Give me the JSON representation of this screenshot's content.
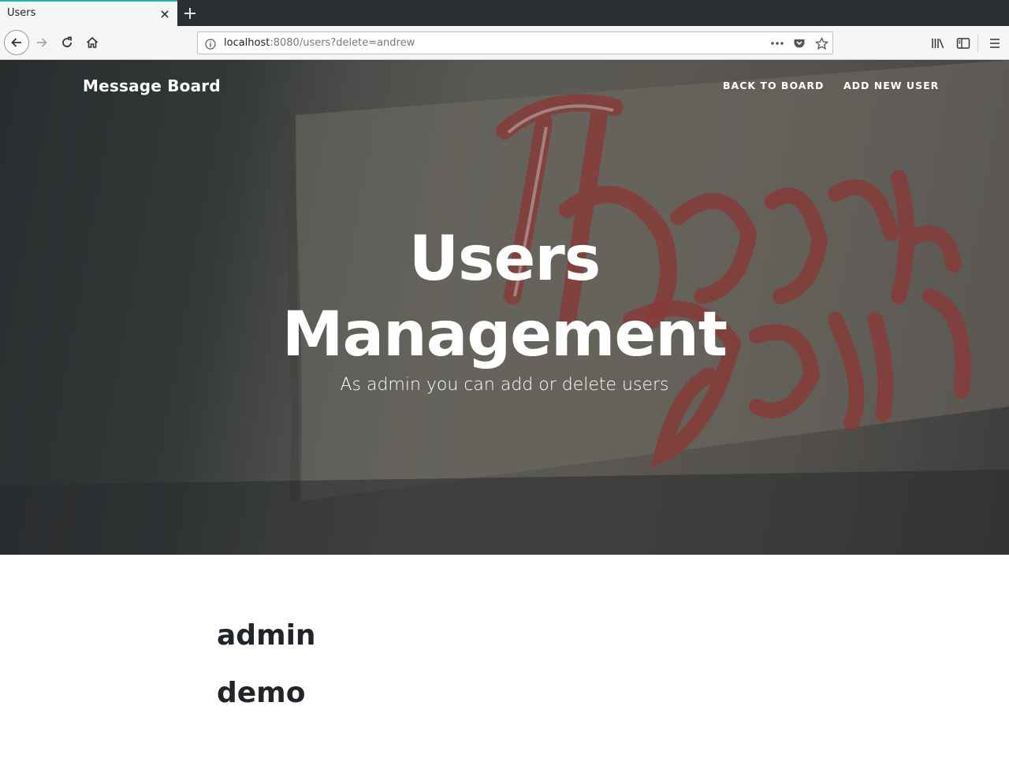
{
  "browser": {
    "tab": {
      "title": "Users"
    },
    "url": {
      "host": "localhost",
      "rest": ":8080/users?delete=andrew"
    }
  },
  "nav": {
    "brand": "Message Board",
    "links": [
      {
        "label": "BACK TO BOARD"
      },
      {
        "label": "ADD NEW USER"
      }
    ]
  },
  "hero": {
    "title_line1": "Users",
    "title_line2": "Management",
    "subtitle": "As admin you can add or delete users"
  },
  "users": [
    "admin",
    "demo"
  ],
  "icons": {
    "tab_close": "close-icon",
    "new_tab": "plus-icon",
    "back": "arrow-left-icon",
    "forward": "arrow-right-icon",
    "reload": "reload-icon",
    "home": "home-icon",
    "info": "info-icon",
    "more": "ellipsis-icon",
    "pocket": "pocket-icon",
    "bookmark": "star-icon",
    "library": "library-icon",
    "sidebar": "sidebar-icon",
    "menu": "hamburger-icon"
  },
  "colors": {
    "tab_accent": "#1fb7a6",
    "heading_text": "#212529",
    "hero_text": "#ffffff"
  }
}
